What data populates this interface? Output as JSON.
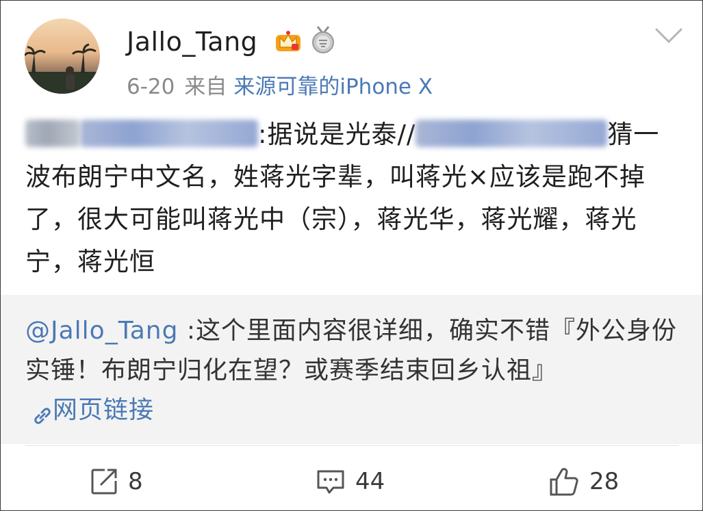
{
  "post": {
    "username": "Jallo_Tang",
    "date": "6-20",
    "from_label": "来自",
    "source": "来源可靠的iPhone X",
    "body_segment_1": ":据说是光泰//",
    "body_segment_2": "猜一波布朗宁中文名，姓蒋光字辈，叫蒋光×应该是跑不掉了，很大可能叫蒋光中（宗），蒋光华，蒋光耀，蒋光宁，蒋光恒"
  },
  "repost": {
    "mention": "@Jallo_Tang",
    "text": " :这个里面内容很详细，确实不错『外公身份实锤！布朗宁归化在望？或赛季结束回乡认祖』",
    "link_label": "网页链接"
  },
  "actions": {
    "repost_count": "8",
    "comment_count": "44",
    "like_count": "28"
  },
  "colors": {
    "link_blue": "#4b79b5",
    "meta_gray": "#8a8a8a",
    "repost_bg": "#f3f3f3"
  }
}
